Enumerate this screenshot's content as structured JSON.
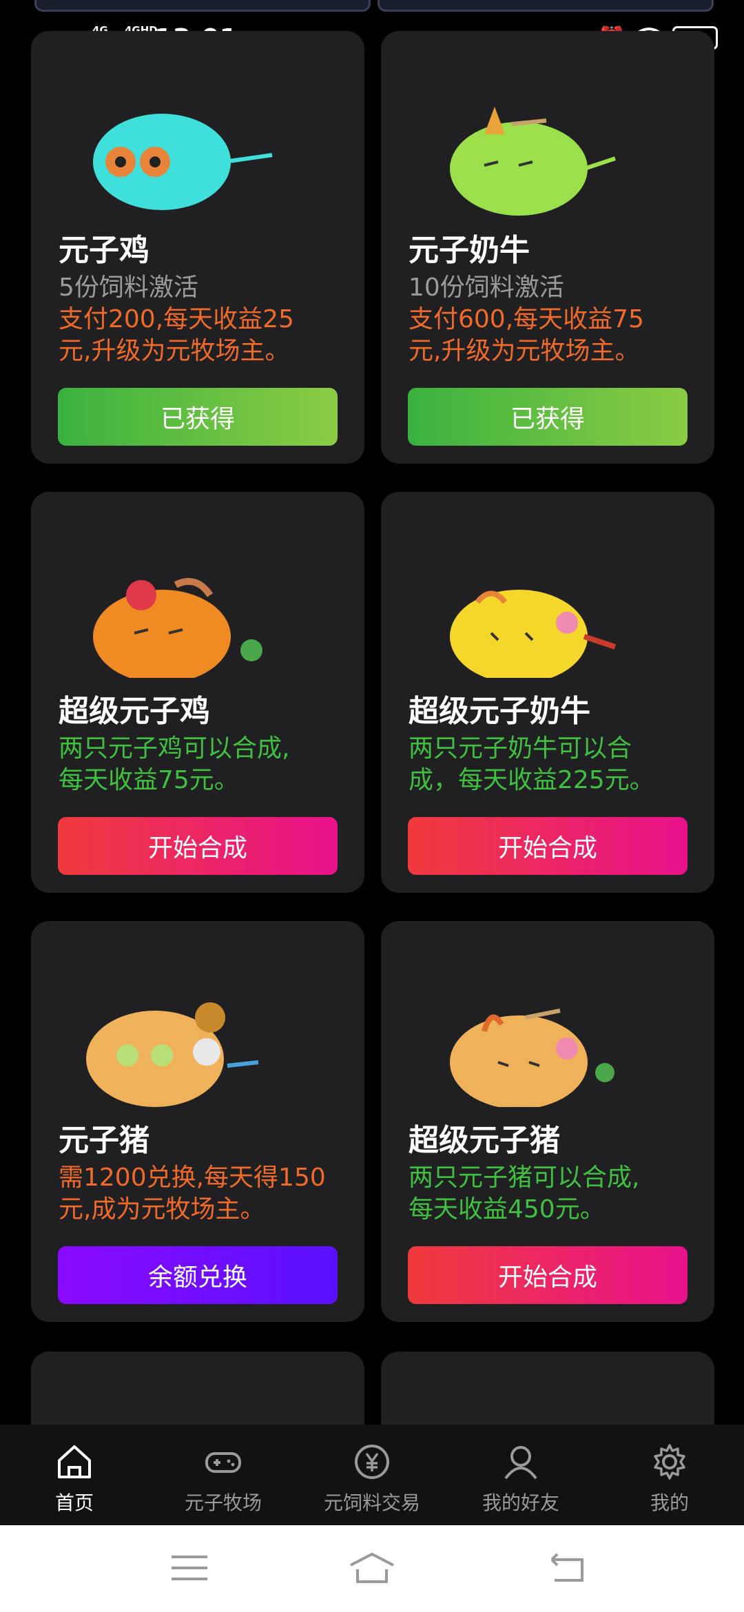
{
  "status": {
    "net1": "4G",
    "net2": "4GHD",
    "time": "13:01",
    "battery": "70"
  },
  "cards": [
    {
      "title": "元子鸡",
      "line1": "5份饲料激活",
      "line2": "支付200,每天收益25",
      "line3": "元,升级为元牧场主。",
      "button": "已获得"
    },
    {
      "title": "元子奶牛",
      "line1": "10份饲料激活",
      "line2": "支付600,每天收益75",
      "line3": "元,升级为元牧场主。",
      "button": "已获得"
    },
    {
      "title": "超级元子鸡",
      "line1": "两只元子鸡可以合成,",
      "line2": "每天收益75元。",
      "button": "开始合成"
    },
    {
      "title": "超级元子奶牛",
      "line1": "两只元子奶牛可以合",
      "line2": "成，每天收益225元。",
      "button": "开始合成"
    },
    {
      "title": "元子猪",
      "line1": "需1200兑换,每天得150",
      "line2": "元,成为元牧场主。",
      "button": "余额兑换"
    },
    {
      "title": "超级元子猪",
      "line1": "两只元子猪可以合成,",
      "line2": "每天收益450元。",
      "button": "开始合成"
    }
  ],
  "tabs": [
    {
      "label": "首页",
      "icon": "home-icon",
      "active": true
    },
    {
      "label": "元子牧场",
      "icon": "gamepad-icon"
    },
    {
      "label": "元饲料交易",
      "icon": "yuan-icon"
    },
    {
      "label": "我的好友",
      "icon": "person-icon"
    },
    {
      "label": "我的",
      "icon": "gear-icon"
    }
  ],
  "nav": [
    "menu-icon",
    "home-outline-icon",
    "back-icon"
  ],
  "colors": {
    "orange_text": "#f06a2a",
    "green_text": "#40c040",
    "green_button": "#3ab23f",
    "red_button": "#ef3a3c",
    "purple_button": "#8a0aff"
  }
}
